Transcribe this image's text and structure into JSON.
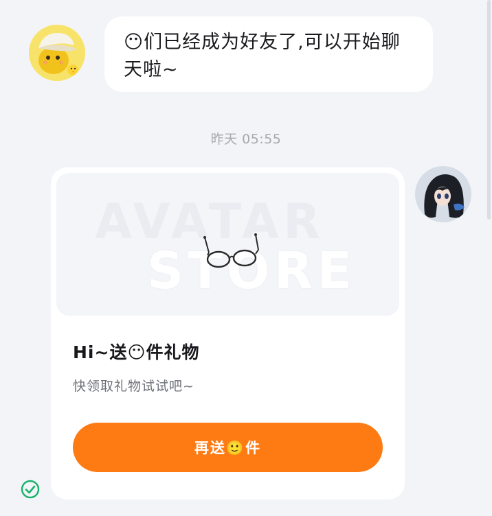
{
  "incoming_message": {
    "text": "😶们已经成为好友了,可以开始聊天啦~"
  },
  "timestamp": "昨天 05:55",
  "gift_card": {
    "banner_watermark_line1": "AVATAR",
    "banner_watermark_line2": "STORE",
    "gift_item_icon": "glasses-icon",
    "title": "Hi~送😶件礼物",
    "description": "快领取礼物试试吧~",
    "button_label": "再送🙂件"
  },
  "status": {
    "icon": "check-circle-icon",
    "color": "#17b26a"
  },
  "colors": {
    "accent": "#fe7a12",
    "background": "#f3f4f8"
  }
}
